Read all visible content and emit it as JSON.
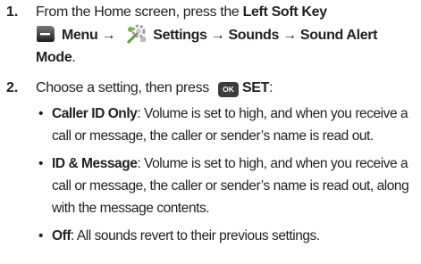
{
  "steps": [
    {
      "number": "1.",
      "line1_prefix": "From the Home screen, press the ",
      "left_soft_key": "Left Soft Key",
      "menu_label": "Menu",
      "arrow1": "→",
      "settings_label": "Settings",
      "arrow2": "→",
      "sounds_label": "Sounds",
      "arrow3": "→",
      "sound_alert_label": "Sound Alert",
      "mode_label": "Mode",
      "period": "."
    },
    {
      "number": "2.",
      "text": "Choose a setting, then press ",
      "ok_key": "OK",
      "set_label": "SET",
      "colon": ":"
    }
  ],
  "bullets": [
    {
      "symbol": "•",
      "term": "Caller ID Only",
      "description": ": Volume is set to high, and when you receive a call or message, the caller or sender’s name is read out."
    },
    {
      "symbol": "•",
      "term": "ID & Message",
      "description": ": Volume is set to high, and when you receive a call or message, the caller or sender’s name is read out, along with the message contents."
    },
    {
      "symbol": "•",
      "term": "Off",
      "description": ": All sounds revert to their previous settings."
    }
  ],
  "icons": {
    "menu": "left-soft-key-icon",
    "settings": "settings-icon",
    "ok": "ok-key-icon"
  },
  "colors": {
    "text": "#231f20",
    "key_background": "#3d3d3d"
  }
}
